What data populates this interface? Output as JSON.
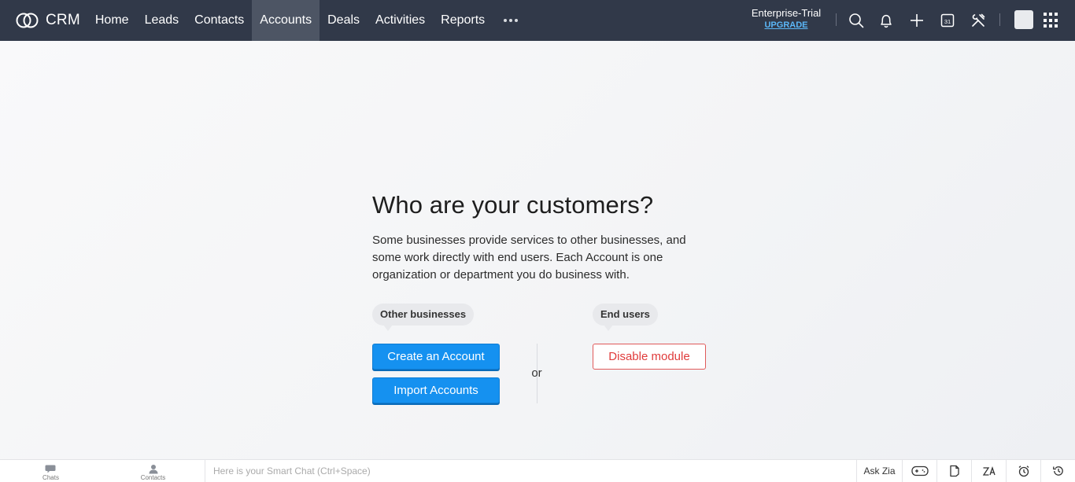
{
  "header": {
    "brand": "CRM",
    "nav": [
      {
        "label": "Home",
        "active": false
      },
      {
        "label": "Leads",
        "active": false
      },
      {
        "label": "Contacts",
        "active": false
      },
      {
        "label": "Accounts",
        "active": true
      },
      {
        "label": "Deals",
        "active": false
      },
      {
        "label": "Activities",
        "active": false
      },
      {
        "label": "Reports",
        "active": false
      }
    ],
    "plan": {
      "name": "Enterprise-Trial",
      "upgrade": "UPGRADE"
    },
    "calendar_day": "31"
  },
  "main": {
    "heading": "Who are your customers?",
    "description": "Some businesses provide services to other businesses, and some work directly with end users. Each Account is one organization or department you do business with.",
    "other_businesses_label": "Other businesses",
    "end_users_label": "End users",
    "create_button": "Create an Account",
    "import_button": "Import Accounts",
    "or_text": "or",
    "disable_button": "Disable module"
  },
  "bottom": {
    "chats_label": "Chats",
    "contacts_label": "Contacts",
    "smart_chat_placeholder": "Here is your Smart Chat (Ctrl+Space)",
    "ask_zia": "Ask Zia"
  },
  "colors": {
    "topbar": "#313949",
    "active_tab": "#4d5564",
    "primary": "#1591f0",
    "danger": "#e03b3b",
    "upgrade_link": "#5bb7f7"
  }
}
